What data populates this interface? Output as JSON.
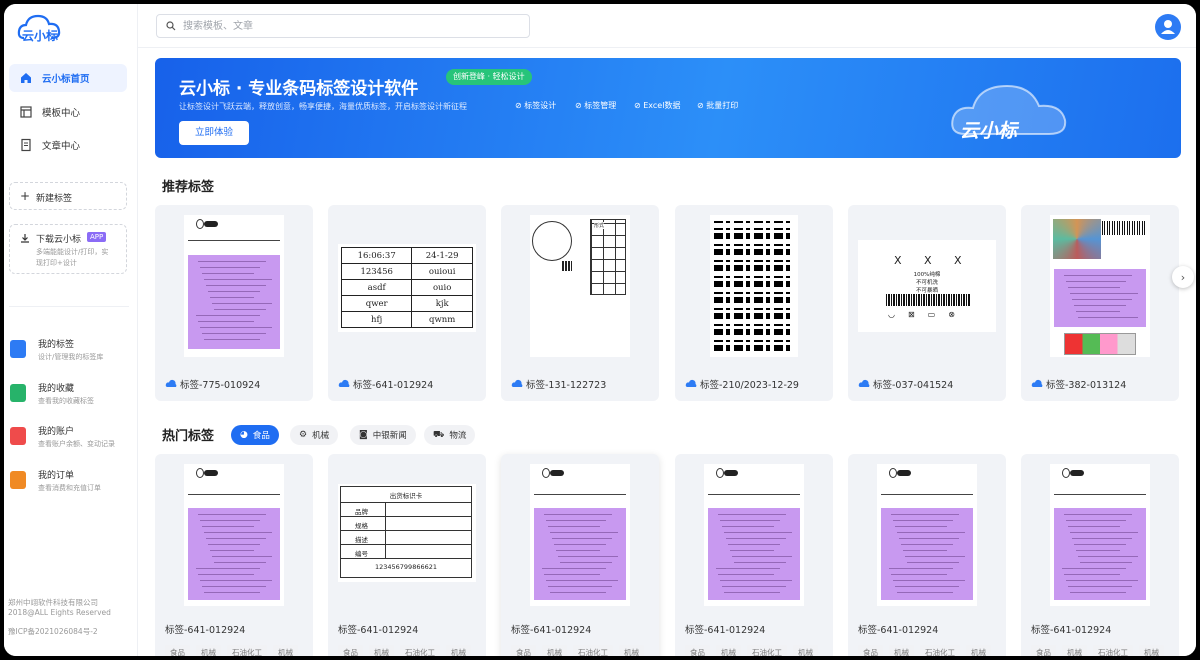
{
  "app": {
    "logo_text": "云小标"
  },
  "search": {
    "placeholder": "搜索模板、文章"
  },
  "sidebar": {
    "nav": [
      {
        "label": "云小标首页",
        "icon": "home-icon"
      },
      {
        "label": "模板中心",
        "icon": "template-icon"
      },
      {
        "label": "文章中心",
        "icon": "article-icon"
      }
    ],
    "new_label": "新建标签",
    "download": {
      "title": "下载云小标",
      "badge": "APP",
      "desc_line1": "多端能能设计/打印，实",
      "desc_line2": "现打印+设计"
    },
    "account": [
      {
        "title": "我的标签",
        "sub": "设计/管理我的标签库",
        "color": "#2d7bf4"
      },
      {
        "title": "我的收藏",
        "sub": "查看我的收藏标签",
        "color": "#27b36a"
      },
      {
        "title": "我的账户",
        "sub": "查看账户余额、变动记录",
        "color": "#ef4b4b"
      },
      {
        "title": "我的订单",
        "sub": "查看消费和充值订单",
        "color": "#f08a24"
      }
    ],
    "footer": {
      "company": "郑州中翊软件科技有限公司",
      "copyright": "2018@ALL Eights Reserved",
      "icp": "豫ICP备2021026084号-2"
    }
  },
  "banner": {
    "title": "云小标 · 专业条码标签设计软件",
    "tag": "创新登峰 · 轻松设计",
    "desc": "让标签设计飞跃云端，释放创意，畅享便捷，海量优质标签，开启标签设计新征程",
    "features": [
      "标签设计",
      "标签管理",
      "Excel数据",
      "批量打印"
    ],
    "button": "立即体验",
    "logo_text": "云小标"
  },
  "recommended": {
    "title": "推荐标签",
    "cards": [
      {
        "name": "标签-775-010924"
      },
      {
        "name": "标签-641-012924"
      },
      {
        "name": "标签-131-122723"
      },
      {
        "name": "标签-210/2023-12-29"
      },
      {
        "name": "标签-037-041524"
      },
      {
        "name": "标签-382-013124"
      }
    ],
    "table_preview": [
      [
        "16:06:37",
        "24-1-29"
      ],
      [
        "123456",
        "ouioui"
      ],
      [
        "asdf",
        "ouio"
      ],
      [
        "qwer",
        "kjk"
      ],
      [
        "hfj",
        "qwnm"
      ]
    ],
    "grid_label": "形式",
    "care_label": {
      "letters": [
        "X",
        "X",
        "X"
      ],
      "line1": "100%纯棉",
      "line2": "不可机洗",
      "line3": "不可暴晒"
    }
  },
  "hot": {
    "title": "热门标签",
    "filters": [
      {
        "label": "食品",
        "active": true
      },
      {
        "label": "机械",
        "active": false
      },
      {
        "label": "中银新闻",
        "active": false
      },
      {
        "label": "物流",
        "active": false
      }
    ],
    "cards": [
      {
        "name": "标签-641-012924",
        "tags": [
          "食品",
          "机械",
          "石油化工",
          "机械"
        ]
      },
      {
        "name": "标签-641-012924",
        "tags": [
          "食品",
          "机械",
          "石油化工",
          "机械"
        ]
      },
      {
        "name": "标签-641-012924",
        "tags": [
          "食品",
          "机械",
          "石油化工",
          "机械"
        ]
      },
      {
        "name": "标签-641-012924",
        "tags": [
          "食品",
          "机械",
          "石油化工",
          "机械"
        ]
      },
      {
        "name": "标签-641-012924",
        "tags": [
          "食品",
          "机械",
          "石油化工",
          "机械"
        ]
      },
      {
        "name": "标签-641-012924",
        "tags": [
          "食品",
          "机械",
          "石油化工",
          "机械"
        ]
      }
    ],
    "shipping": {
      "title": "出货标识卡",
      "rows": [
        "品牌",
        "规格",
        "描述",
        "编号"
      ],
      "code": "123456799866621"
    }
  }
}
